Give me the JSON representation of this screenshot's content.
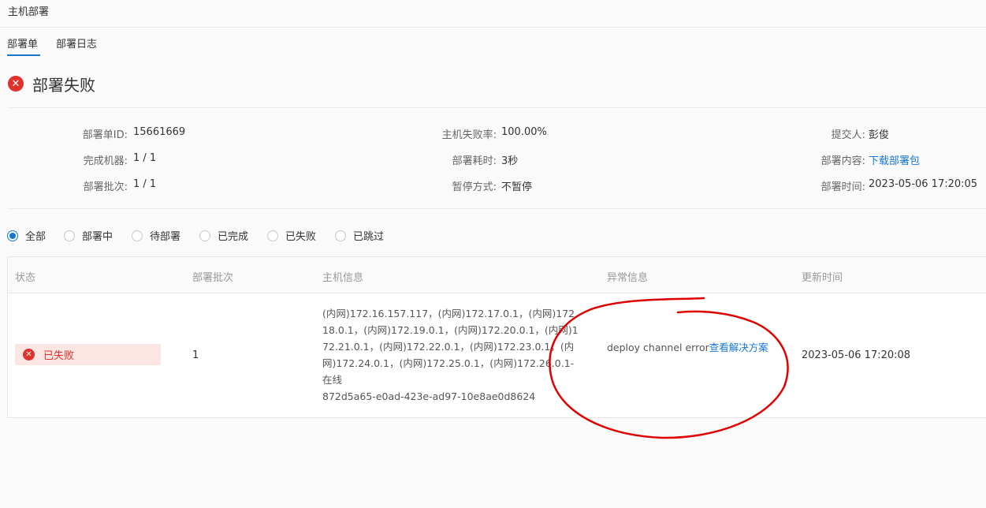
{
  "header": {
    "title": "主机部署"
  },
  "tabs": [
    {
      "label": "部署单",
      "active": true
    },
    {
      "label": "部署日志",
      "active": false
    }
  ],
  "status": {
    "icon": "close-circle-icon",
    "title": "部署失败",
    "color": "#e0322b"
  },
  "info": {
    "order_id_label": "部署单ID:",
    "order_id": "15661669",
    "fail_rate_label": "主机失败率:",
    "fail_rate": "100.00%",
    "submitter_label": "提交人:",
    "submitter": "彭俊",
    "machines_label": "完成机器:",
    "machines": "1 / 1",
    "duration_label": "部署耗时:",
    "duration": "3秒",
    "content_label": "部署内容:",
    "content_link": "下载部署包",
    "batch_label": "部署批次:",
    "batch": "1 / 1",
    "pause_label": "暂停方式:",
    "pause": "不暂停",
    "time_label": "部署时间:",
    "time": "2023-05-06 17:20:05"
  },
  "filters": [
    {
      "label": "全部",
      "checked": true
    },
    {
      "label": "部署中",
      "checked": false
    },
    {
      "label": "待部署",
      "checked": false
    },
    {
      "label": "已完成",
      "checked": false
    },
    {
      "label": "已失败",
      "checked": false
    },
    {
      "label": "已跳过",
      "checked": false
    }
  ],
  "table": {
    "columns": [
      "状态",
      "部署批次",
      "主机信息",
      "异常信息",
      "更新时间"
    ],
    "rows": [
      {
        "status": "已失败",
        "batch": "1",
        "host_info": "(内网)172.16.157.117，(内网)172.17.0.1，(内网)172.18.0.1，(内网)172.19.0.1，(内网)172.20.0.1，(内网)172.21.0.1，(内网)172.22.0.1，(内网)172.23.0.1，(内网)172.24.0.1，(内网)172.25.0.1，(内网)172.26.0.1-在线",
        "host_id": "872d5a65-e0ad-423e-ad97-10e8ae0d8624",
        "error": "deploy channel error",
        "error_link": "查看解决方案",
        "updated": "2023-05-06 17:20:08"
      }
    ]
  },
  "colors": {
    "accent": "#1677d2",
    "error": "#e0322b",
    "annotation": "#e00000"
  }
}
